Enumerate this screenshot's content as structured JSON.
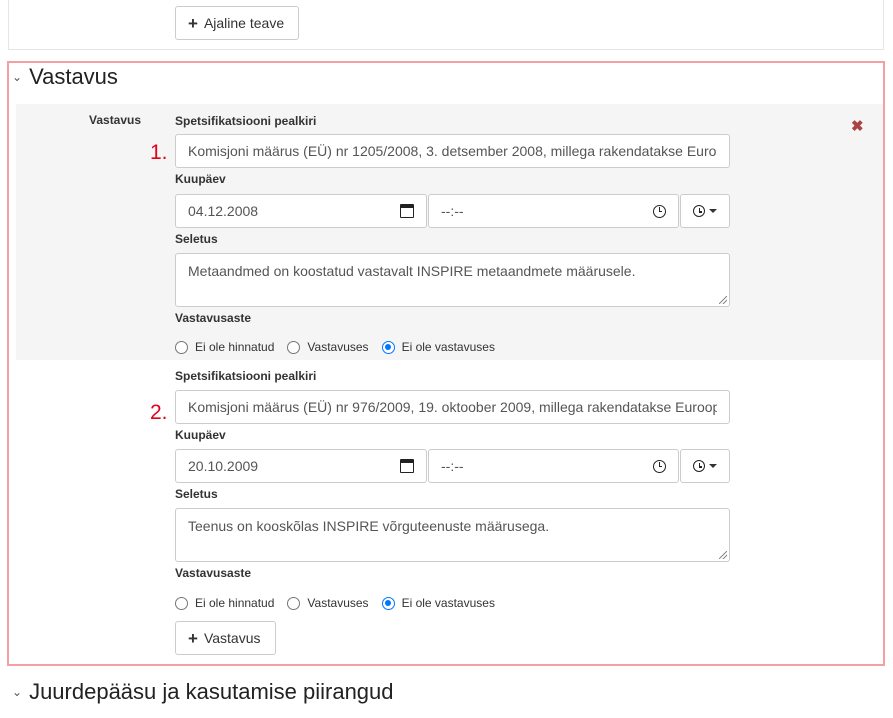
{
  "top_section": {
    "add_button_label": "Ajaline teave"
  },
  "conformity_section": {
    "title": "Vastavus",
    "side_label": "Vastavus",
    "entries": [
      {
        "number": "1.",
        "spec_title_label": "Spetsifikatsiooni pealkiri",
        "spec_title_value": "Komisjoni määrus (EÜ) nr 1205/2008, 3. detsember 2008, millega rakendatakse Euro",
        "date_label": "Kuupäev",
        "date_value": "04.12.2008",
        "time_value": "--:--",
        "explanation_label": "Seletus",
        "explanation_value": "Metaandmed on koostatud vastavalt INSPIRE metaandmete määrusele.",
        "degree_label": "Vastavusaste",
        "degree_options": [
          "Ei ole hinnatud",
          "Vastavuses",
          "Ei ole vastavuses"
        ],
        "degree_selected": "Ei ole vastavuses"
      },
      {
        "number": "2.",
        "spec_title_label": "Spetsifikatsiooni pealkiri",
        "spec_title_value": "Komisjoni määrus (EÜ) nr 976/2009, 19. oktoober 2009, millega rakendatakse Euroop",
        "date_label": "Kuupäev",
        "date_value": "20.10.2009",
        "time_value": "--:--",
        "explanation_label": "Seletus",
        "explanation_value": "Teenus on kooskõlas INSPIRE võrguteenuste määrusega.",
        "degree_label": "Vastavusaste",
        "degree_options": [
          "Ei ole hinnatud",
          "Vastavuses",
          "Ei ole vastavuses"
        ],
        "degree_selected": "Ei ole vastavuses"
      }
    ],
    "add_button_label": "Vastavus"
  },
  "next_section": {
    "title": "Juurdepääsu ja kasutamise piirangud"
  },
  "icons": {
    "remove": "close-icon",
    "add": "plus-icon",
    "calendar": "calendar-icon",
    "clock": "clock-icon",
    "collapse": "chevron-down-icon"
  },
  "colors": {
    "highlight_border": "#f2a0a4",
    "annotation_number": "#e3001b",
    "remove_icon": "#a94442",
    "radio_checked": "#0075ff"
  }
}
